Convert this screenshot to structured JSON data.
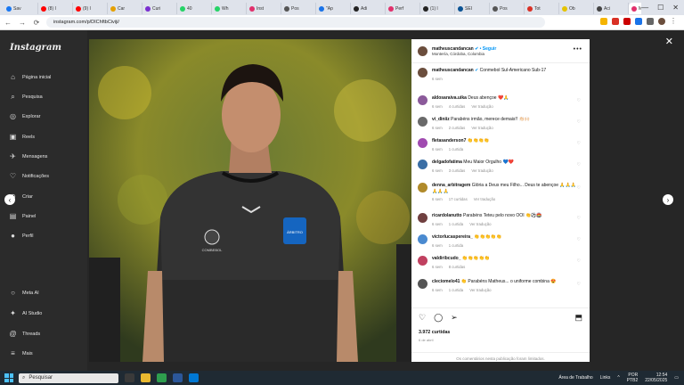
{
  "browser": {
    "tabs": [
      {
        "label": "Sav",
        "color": "#1877f2"
      },
      {
        "label": "(8) I",
        "color": "#ff0000"
      },
      {
        "label": "(9) I",
        "color": "#ff0000"
      },
      {
        "label": "Car",
        "color": "#e5a000"
      },
      {
        "label": "Curi",
        "color": "#7a2fd0"
      },
      {
        "label": "40",
        "color": "#25d366"
      },
      {
        "label": "Wh",
        "color": "#25d366"
      },
      {
        "label": "Inst",
        "color": "#e1306c"
      },
      {
        "label": "Pos",
        "color": "#555"
      },
      {
        "label": "\"Ap",
        "color": "#1a73e8"
      },
      {
        "label": "Adi",
        "color": "#222"
      },
      {
        "label": "Perf",
        "color": "#e1306c"
      },
      {
        "label": "(1) l",
        "color": "#222"
      },
      {
        "label": "SEI",
        "color": "#0b5394"
      },
      {
        "label": "Pos",
        "color": "#555"
      },
      {
        "label": "Tot",
        "color": "#d93025"
      },
      {
        "label": "Ob",
        "color": "#e5c300"
      },
      {
        "label": "Aci",
        "color": "#444"
      },
      {
        "label": "Ma",
        "color": "#e1306c"
      }
    ],
    "new_tab": "+",
    "window_controls": [
      "—",
      "☐",
      "✕"
    ],
    "url": "instagram.com/p/DIChftbCiviji/"
  },
  "sidebar": {
    "logo": "Instagram",
    "items": [
      {
        "label": "Página inicial",
        "icon": "⌂"
      },
      {
        "label": "Pesquisa",
        "icon": "⌕"
      },
      {
        "label": "Explorar",
        "icon": "◎"
      },
      {
        "label": "Reels",
        "icon": "▣"
      },
      {
        "label": "Mensagens",
        "icon": "✈"
      },
      {
        "label": "Notificações",
        "icon": "♡"
      },
      {
        "label": "Criar",
        "icon": "⊕"
      },
      {
        "label": "Painel",
        "icon": "▤"
      },
      {
        "label": "Perfil",
        "icon": "●"
      }
    ],
    "bottom_items": [
      {
        "label": "Meta AI",
        "icon": "○"
      },
      {
        "label": "AI Studio",
        "icon": "✦"
      },
      {
        "label": "Threads",
        "icon": "@"
      },
      {
        "label": "Mais",
        "icon": "≡"
      }
    ]
  },
  "post": {
    "username": "matheuscandancan",
    "verified": "✔",
    "follow_label": "• Seguir",
    "location": "Montería, Córdoba, Colombia",
    "caption_user": "matheuscandancan",
    "caption": "Conmebol Sul-Americano Sub-17",
    "caption_time": "6 sem",
    "comments": [
      {
        "user": "aldosaraiva.uika",
        "text": "Deus abençoe ❤️🙏",
        "time": "6 sem",
        "likes": "4 curtidas",
        "reply": "Ver tradução",
        "avatar": "#8b5a9a"
      },
      {
        "user": "vi_diniiz",
        "text": "Parabéns irmão, merece demais!! 👏🏻🙌🏻",
        "time": "6 sem",
        "likes": "2 curtidas",
        "reply": "Ver tradução",
        "avatar": "#6a6a6a"
      },
      {
        "user": "fletasanderson7",
        "text": "👏👏👏👏",
        "time": "6 sem",
        "likes": "1 curtida",
        "reply": "",
        "avatar": "#a04ab0"
      },
      {
        "user": "delgadofatima",
        "text": "Meu Maior Orgulho 💙❤️",
        "time": "6 sem",
        "likes": "3 curtidas",
        "reply": "Ver tradução",
        "avatar": "#3a6ea5"
      },
      {
        "user": "denna_arbitragem",
        "text": "Glória a Deus meu Filho... Deus te abençoe 🙏🙏🙏🙏🙏🙏",
        "time": "6 sem",
        "likes": "17 curtidas",
        "reply": "Ver tradução",
        "avatar": "#b08a2a"
      },
      {
        "user": "ricardolanutto",
        "text": "Parabéns Teteu pelo novo OOI 👏⚽🏟️",
        "time": "6 sem",
        "likes": "1 curtida",
        "reply": "Ver tradução",
        "avatar": "#704040"
      },
      {
        "user": "victorlucaspereira_",
        "text": "👏👏👏👏👏",
        "time": "6 sem",
        "likes": "1 curtida",
        "reply": "",
        "avatar": "#4a8ad0"
      },
      {
        "user": "valdiribcudo_",
        "text": "👏👏👏👏👏",
        "time": "6 sem",
        "likes": "8 curtidas",
        "reply": "",
        "avatar": "#c04060"
      },
      {
        "user": "cleciomelo41",
        "text": "👏 Parabéns Matheus... o uniforme combina 😍",
        "time": "6 sem",
        "likes": "1 curtida",
        "reply": "Ver tradução",
        "avatar": "#555"
      }
    ],
    "likes_count": "3.972 curtidas",
    "date": "6 de abril",
    "comments_disabled": "Os comentários nesta publicação foram limitados."
  },
  "overlay": {
    "close": "✕",
    "prev": "‹",
    "next": "›"
  },
  "photo": {
    "badge": "ÁRBITRO",
    "crest": "COMBEBOL"
  },
  "taskbar": {
    "search_placeholder": "Pesquisar",
    "tray_desktop": "Área de Trabalho",
    "tray_links": "Links",
    "lang": "POR",
    "layout": "PTB2",
    "time": "12:54",
    "date": "22/05/2025"
  }
}
